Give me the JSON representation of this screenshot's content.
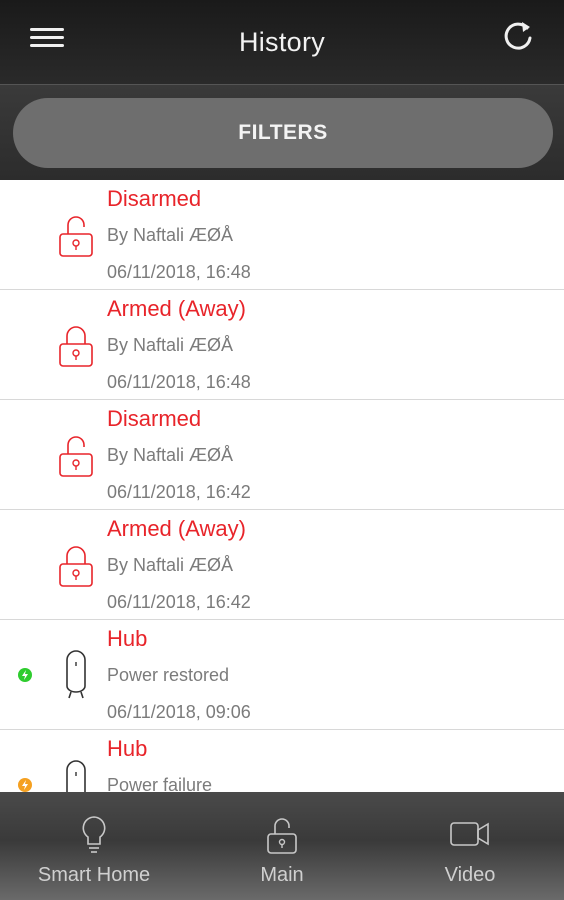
{
  "header": {
    "title": "History"
  },
  "filters": {
    "label": "FILTERS"
  },
  "history": [
    {
      "event": "Disarmed",
      "detail": "By Naftali ÆØÅ",
      "time": "06/11/2018, 16:48",
      "icon": "unlocked-padlock-icon"
    },
    {
      "event": "Armed (Away)",
      "detail": "By Naftali ÆØÅ",
      "time": "06/11/2018, 16:48",
      "icon": "locked-padlock-icon"
    },
    {
      "event": "Disarmed",
      "detail": "By Naftali ÆØÅ",
      "time": "06/11/2018, 16:42",
      "icon": "unlocked-padlock-icon"
    },
    {
      "event": "Armed (Away)",
      "detail": "By Naftali ÆØÅ",
      "time": "06/11/2018, 16:42",
      "icon": "locked-padlock-icon"
    },
    {
      "event": "Hub",
      "detail": "Power restored",
      "time": "06/11/2018, 09:06",
      "icon": "hub-icon",
      "status": "power-restored-icon",
      "status_color": "#2ecc2e"
    },
    {
      "event": "Hub",
      "detail": "Power failure",
      "time": "",
      "icon": "hub-icon",
      "status": "power-failure-icon",
      "status_color": "#f5a020"
    }
  ],
  "nav": {
    "smart_home": "Smart Home",
    "main": "Main",
    "video": "Video"
  },
  "colors": {
    "accent_red": "#e8242a",
    "secondary_text": "#7b7b7b"
  }
}
